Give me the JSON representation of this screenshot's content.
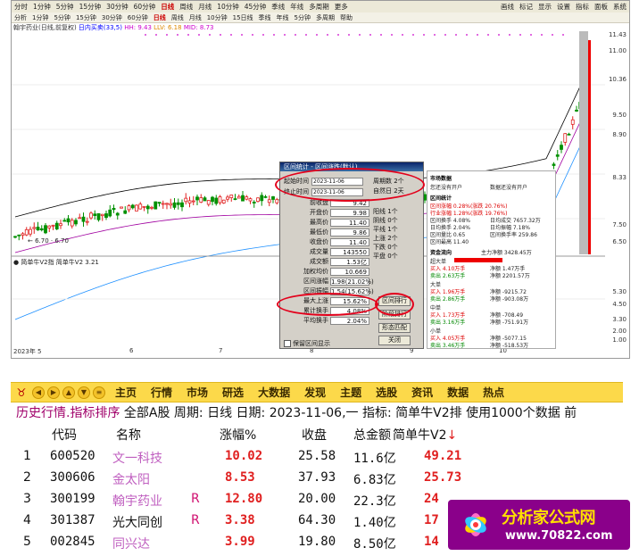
{
  "top": {
    "menu": [
      "分时",
      "1分钟",
      "5分钟",
      "15分钟",
      "30分钟",
      "60分钟",
      "日线",
      "周线",
      "月线",
      "10分钟",
      "45分钟",
      "季线",
      "年线",
      "多周期",
      "更多"
    ],
    "menu_right": [
      "画线",
      "标记",
      "显示",
      "设置",
      "指标",
      "面板",
      "系统"
    ],
    "active_menu": "日线",
    "period": [
      "分析",
      "1分钟",
      "5分钟",
      "15分钟",
      "30分钟",
      "60分钟",
      "日线",
      "周线",
      "月线",
      "10分钟",
      "15日线",
      "季线",
      "年线",
      "5分钟",
      "多周期",
      "帮助"
    ],
    "active_period": "日线",
    "infoline": {
      "stock": "翰宇药业(日线,前复权)",
      "ind1": "日内买卖(33,5)",
      "v1": "HH: 9.43",
      "v2": "LLV: 6.18",
      "v3": "MID: 8.73"
    },
    "price_low_label": "← 6.70 · 6.70",
    "subtitle": "● 简单牛V2指 简单牛V2 3.21",
    "right_axis": [
      "11.43",
      "11.00",
      "10.36",
      "9.50",
      "8.90",
      "8.33",
      "7.50",
      "6.50",
      "5.30",
      "4.50",
      "3.30",
      "2.00",
      "1.00"
    ],
    "date_axis": [
      "2023年 5",
      "6",
      "7",
      "8",
      "9",
      "10"
    ],
    "dialog": {
      "title": "区间统计 - 区间涨跌(默认)",
      "start_label": "起始时间",
      "start_value": "2023-11-06",
      "end_label": "终止时间",
      "end_value": "2023-11-06",
      "period_count": "周期数 2个",
      "natural_days": "自然日 2天",
      "rows": [
        {
          "label": "前收盘",
          "value": "9.42"
        },
        {
          "label": "开盘价",
          "value": "9.98"
        },
        {
          "label": "最高价",
          "value": "11.40"
        },
        {
          "label": "最低价",
          "value": "9.86"
        },
        {
          "label": "收盘价",
          "value": "11.40"
        },
        {
          "label": "成交量",
          "value": "143550"
        },
        {
          "label": "成交额",
          "value": "1.53亿"
        },
        {
          "label": "加权均价",
          "value": "10.669"
        },
        {
          "label": "区间涨幅",
          "value": "1.98(21.02%)"
        },
        {
          "label": "区间振幅",
          "value": "1.54(15.62%)"
        },
        {
          "label": "最大上涨",
          "value": "15.62%"
        },
        {
          "label": "累计换手",
          "value": "4.08%"
        },
        {
          "label": "平均换手",
          "value": "2.04%"
        }
      ],
      "counts": [
        "阳线 1个",
        "阴线 0个",
        "平线 1个",
        "上涨 2个",
        "下跌 0个",
        "平盘 0个"
      ],
      "btn_export": "区间排行",
      "btn_other": "阶段排行",
      "btn_form": "形态匹配",
      "btn_close": "关闭",
      "check_label": "保留区间显示"
    },
    "panel": {
      "sec1": "市场数据",
      "sec1_l": "您还没有开户",
      "sec1_r": "数据还没有开户",
      "sec2": "区间统计",
      "l1": "区间涨幅 0.28%(涨跌 20.76%)",
      "l2": "行业涨幅 1.28%(涨跌 19.76%)",
      "l3": "区间换手 4.08%",
      "l4": "日均成交 7657.32万",
      "l5": "日均换手 2.04%",
      "l6": "日均振幅 7.18%",
      "l7": "区间量比 0.65",
      "l8": "区间换手率 259.86",
      "l9": "区间最高 11.40",
      "sec3": "资金流向",
      "sec3_v": "主力净额 3428.45万",
      "big": "超大单",
      "big_buy": "买入 4.10万手",
      "big_sell": "卖出 2.63万手",
      "big_in": "净额 1.47万手",
      "big_net": "净额 2201.57万",
      "mid": "大单",
      "mid_buy": "买入 1.96万手",
      "mid_sell": "卖出 2.86万手",
      "mid_net": "净额 -9215.72",
      "mid_net2": "净额 -903.08万",
      "small": "中单",
      "small_buy": "买入 1.73万手",
      "small_sell": "卖出 3.16万手",
      "small_net": "净额 -708.49",
      "small_net2": "净额 -751.91万",
      "tiny": "小单",
      "tiny_buy": "买入 4.05万手",
      "tiny_sell": "卖出 3.46万手",
      "tiny_net": "净额 -5077.15",
      "tiny_net2": "净额 -518.53万"
    }
  },
  "navbar": {
    "items": [
      "主页",
      "行情",
      "市场",
      "研选",
      "大数据",
      "发现",
      "主题",
      "选股",
      "资讯",
      "数据",
      "热点"
    ]
  },
  "header": {
    "pre": "历史行情.指标排序",
    "rest": " 全部A股 周期: 日线 日期: 2023-11-06,一 指标: 简单牛V2排  使用1000个数据 前"
  },
  "columns": {
    "code": "代码",
    "name": "名称",
    "pct": "涨幅%",
    "close": "收盘",
    "amount": "总金额",
    "ind": "简单牛V2",
    "sort_arrow": "↓"
  },
  "rows": [
    {
      "idx": "1",
      "code": "600520",
      "name": "文一科技",
      "flag": "",
      "pct": "10.02",
      "close": "25.58",
      "amount": "11.6亿",
      "ind": "49.21",
      "name_color": "#c060c0"
    },
    {
      "idx": "2",
      "code": "300606",
      "name": "金太阳",
      "flag": "",
      "pct": "8.53",
      "close": "37.93",
      "amount": "6.83亿",
      "ind": "25.73",
      "name_color": "#c060c0"
    },
    {
      "idx": "3",
      "code": "300199",
      "name": "翰宇药业",
      "flag": "R",
      "pct": "12.80",
      "close": "20.00",
      "amount": "22.3亿",
      "ind": "24",
      "name_color": "#c060c0"
    },
    {
      "idx": "4",
      "code": "301387",
      "name": "光大同创",
      "flag": "R",
      "pct": "3.38",
      "close": "64.30",
      "amount": "1.40亿",
      "ind": "17",
      "name_color": "#111111"
    },
    {
      "idx": "5",
      "code": "002845",
      "name": "同兴达",
      "flag": "",
      "pct": "3.99",
      "close": "19.80",
      "amount": "8.50亿",
      "ind": "14",
      "name_color": "#c060c0"
    }
  ],
  "badge": {
    "title": "分析家公式网",
    "url": "www.70822.com"
  },
  "colors": {
    "up": "#e02020",
    "down": "#008000",
    "nav_bg": "#fcd94a",
    "badge_bg": "#8a008a"
  }
}
